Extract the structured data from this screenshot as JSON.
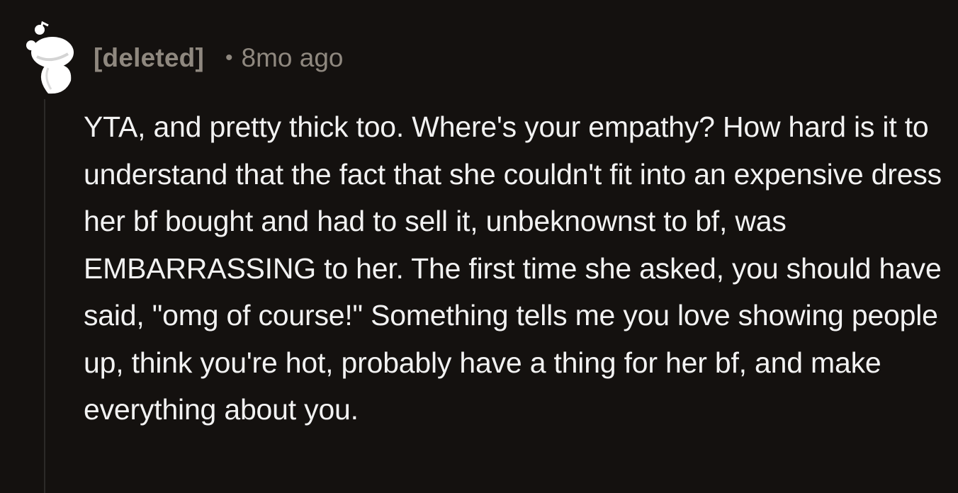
{
  "comment": {
    "author": "[deleted]",
    "separator": "•",
    "time": "8mo ago",
    "text": "YTA, and pretty thick too. Where's your empathy? How hard is it to understand that the fact that she couldn't fit into an expensive dress her bf bought and had to sell it, unbeknownst to bf, was EMBARRASSING to her. The first time she asked, you should have said, \"omg of course!\" Something tells me you love showing people up, think you're hot, probably have a thing for her bf, and make everything about you.",
    "avatar_icon": "deleted-user-snoo-icon"
  },
  "colors": {
    "background": "#14110f",
    "meta_text": "#8f887f",
    "body_text": "#f2f2f2",
    "thread_line": "#2c2a28"
  }
}
